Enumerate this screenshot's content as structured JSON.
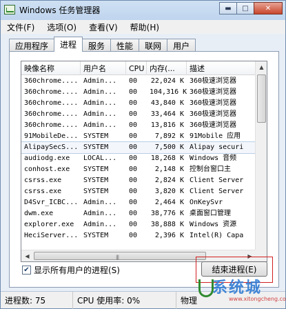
{
  "window": {
    "title": "Windows 任务管理器",
    "min": "▬",
    "max": "□",
    "close": "✕"
  },
  "menu": [
    {
      "label": "文件(F)"
    },
    {
      "label": "选项(O)"
    },
    {
      "label": "查看(V)"
    },
    {
      "label": "帮助(H)"
    }
  ],
  "tabs": [
    {
      "label": "应用程序"
    },
    {
      "label": "进程"
    },
    {
      "label": "服务"
    },
    {
      "label": "性能"
    },
    {
      "label": "联网"
    },
    {
      "label": "用户"
    }
  ],
  "columns": {
    "name": "映像名称",
    "user": "用户名",
    "cpu": "CPU",
    "mem": "内存(...",
    "desc": "描述"
  },
  "processes": [
    {
      "name": "360chrome....",
      "user": "Admin...",
      "cpu": "00",
      "mem": "22,024 K",
      "desc": "360极速浏览器"
    },
    {
      "name": "360chrome....",
      "user": "Admin...",
      "cpu": "00",
      "mem": "104,316 K",
      "desc": "360极速浏览器"
    },
    {
      "name": "360chrome....",
      "user": "Admin...",
      "cpu": "00",
      "mem": "43,840 K",
      "desc": "360极速浏览器"
    },
    {
      "name": "360chrome....",
      "user": "Admin...",
      "cpu": "00",
      "mem": "33,464 K",
      "desc": "360极速浏览器"
    },
    {
      "name": "360chrome....",
      "user": "Admin...",
      "cpu": "00",
      "mem": "13,816 K",
      "desc": "360极速浏览器"
    },
    {
      "name": "91MobileDe...",
      "user": "SYSTEM",
      "cpu": "00",
      "mem": "7,892 K",
      "desc": "91Mobile 应用"
    },
    {
      "name": "AlipaySecS...",
      "user": "SYSTEM",
      "cpu": "00",
      "mem": "7,500 K",
      "desc": "Alipay securi"
    },
    {
      "name": "audiodg.exe",
      "user": "LOCAL...",
      "cpu": "00",
      "mem": "18,268 K",
      "desc": "Windows 音频"
    },
    {
      "name": "conhost.exe",
      "user": "SYSTEM",
      "cpu": "00",
      "mem": "2,148 K",
      "desc": "控制台窗口主"
    },
    {
      "name": "csrss.exe",
      "user": "SYSTEM",
      "cpu": "00",
      "mem": "2,824 K",
      "desc": "Client Server"
    },
    {
      "name": "csrss.exe",
      "user": "SYSTEM",
      "cpu": "00",
      "mem": "3,820 K",
      "desc": "Client Server"
    },
    {
      "name": "D4Svr_ICBC...",
      "user": "Admin...",
      "cpu": "00",
      "mem": "2,464 K",
      "desc": "OnKeySvr"
    },
    {
      "name": "dwm.exe",
      "user": "Admin...",
      "cpu": "00",
      "mem": "38,776 K",
      "desc": "桌面窗口管理"
    },
    {
      "name": "explorer.exe",
      "user": "Admin...",
      "cpu": "00",
      "mem": "38,888 K",
      "desc": "Windows 资源"
    },
    {
      "name": "HeciServer...",
      "user": "SYSTEM",
      "cpu": "00",
      "mem": "2,396 K",
      "desc": "Intel(R) Capa"
    }
  ],
  "show_all_label": "显示所有用户的进程(S)",
  "end_process_label": "结束进程(E)",
  "status": {
    "processes": "进程数: 75",
    "cpu": "CPU 使用率: 0%",
    "mem": "物理"
  },
  "watermark": {
    "title": "系统城",
    "site": "www.xitongcheng.com"
  }
}
